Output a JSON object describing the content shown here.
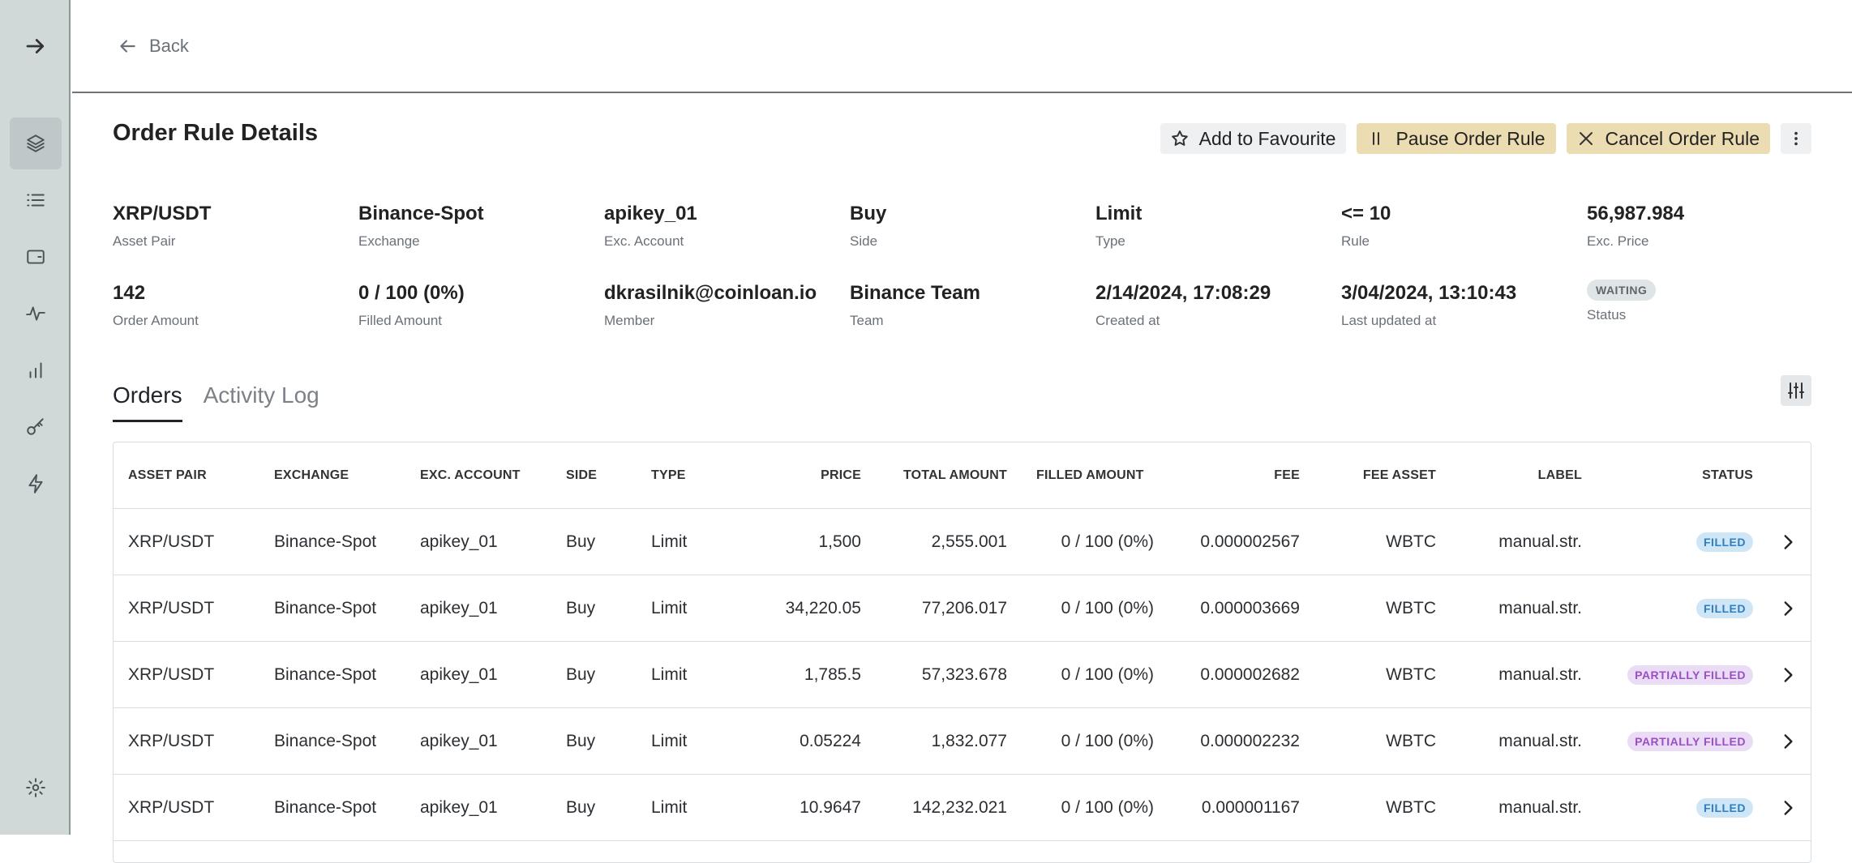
{
  "top": {
    "back_label": "Back"
  },
  "sidebar": {
    "items": [
      {
        "icon": "arrow-right-icon"
      },
      {
        "icon": "layers-icon"
      },
      {
        "icon": "list-icon"
      },
      {
        "icon": "wallet-icon"
      },
      {
        "icon": "activity-icon"
      },
      {
        "icon": "bar-chart-icon"
      },
      {
        "icon": "key-icon"
      },
      {
        "icon": "lightning-icon"
      },
      {
        "icon": "settings-icon"
      }
    ]
  },
  "header": {
    "title": "Order Rule Details",
    "add_favourite": "Add to Favourite",
    "pause": "Pause Order Rule",
    "cancel": "Cancel Order Rule"
  },
  "details": [
    {
      "value": "XRP/USDT",
      "label": "Asset Pair"
    },
    {
      "value": "Binance-Spot",
      "label": "Exchange"
    },
    {
      "value": "apikey_01",
      "label": "Exc. Account"
    },
    {
      "value": "Buy",
      "label": "Side"
    },
    {
      "value": "Limit",
      "label": "Type"
    },
    {
      "value": "<= 10",
      "label": "Rule"
    },
    {
      "value": "56,987.984",
      "label": "Exc. Price"
    },
    {
      "value": "142",
      "label": "Order Amount"
    },
    {
      "value": "0 / 100 (0%)",
      "label": "Filled Amount"
    },
    {
      "value": "dkrasilnik@coinloan.io",
      "label": "Member"
    },
    {
      "value": "Binance Team",
      "label": "Team"
    },
    {
      "value": "2/14/2024, 17:08:29",
      "label": "Created at"
    },
    {
      "value": "3/04/2024, 13:10:43",
      "label": "Last updated at"
    },
    {
      "value": "WAITING",
      "label": "Status"
    }
  ],
  "tabs": [
    "Orders",
    "Activity Log"
  ],
  "table": {
    "columns": [
      "ASSET PAIR",
      "EXCHANGE",
      "EXC. ACCOUNT",
      "SIDE",
      "TYPE",
      "PRICE",
      "TOTAL AMOUNT",
      "FILLED AMOUNT",
      "FEE",
      "FEE ASSET",
      "LABEL",
      "STATUS"
    ],
    "rows": [
      [
        "XRP/USDT",
        "Binance-Spot",
        "apikey_01",
        "Buy",
        "Limit",
        "1,500",
        "2,555.001",
        "0 / 100 (0%)",
        "0.000002567",
        "WBTC",
        "manual.str.",
        "FILLED"
      ],
      [
        "XRP/USDT",
        "Binance-Spot",
        "apikey_01",
        "Buy",
        "Limit",
        "34,220.05",
        "77,206.017",
        "0 / 100 (0%)",
        "0.000003669",
        "WBTC",
        "manual.str.",
        "FILLED"
      ],
      [
        "XRP/USDT",
        "Binance-Spot",
        "apikey_01",
        "Buy",
        "Limit",
        "1,785.5",
        "57,323.678",
        "0 / 100 (0%)",
        "0.000002682",
        "WBTC",
        "manual.str.",
        "PARTIALLY FILLED"
      ],
      [
        "XRP/USDT",
        "Binance-Spot",
        "apikey_01",
        "Buy",
        "Limit",
        "0.05224",
        "1,832.077",
        "0 / 100 (0%)",
        "0.000002232",
        "WBTC",
        "manual.str.",
        "PARTIALLY FILLED"
      ],
      [
        "XRP/USDT",
        "Binance-Spot",
        "apikey_01",
        "Buy",
        "Limit",
        "10.9647",
        "142,232.021",
        "0 / 100 (0%)",
        "0.000001167",
        "WBTC",
        "manual.str.",
        "FILLED"
      ]
    ]
  },
  "colors": {
    "sidebar_bg": "#d1d8d8",
    "warn_button_bg": "#ecdcb2",
    "filled_badge_bg": "#cfe6f7",
    "partial_badge_bg": "#eadcf5"
  }
}
